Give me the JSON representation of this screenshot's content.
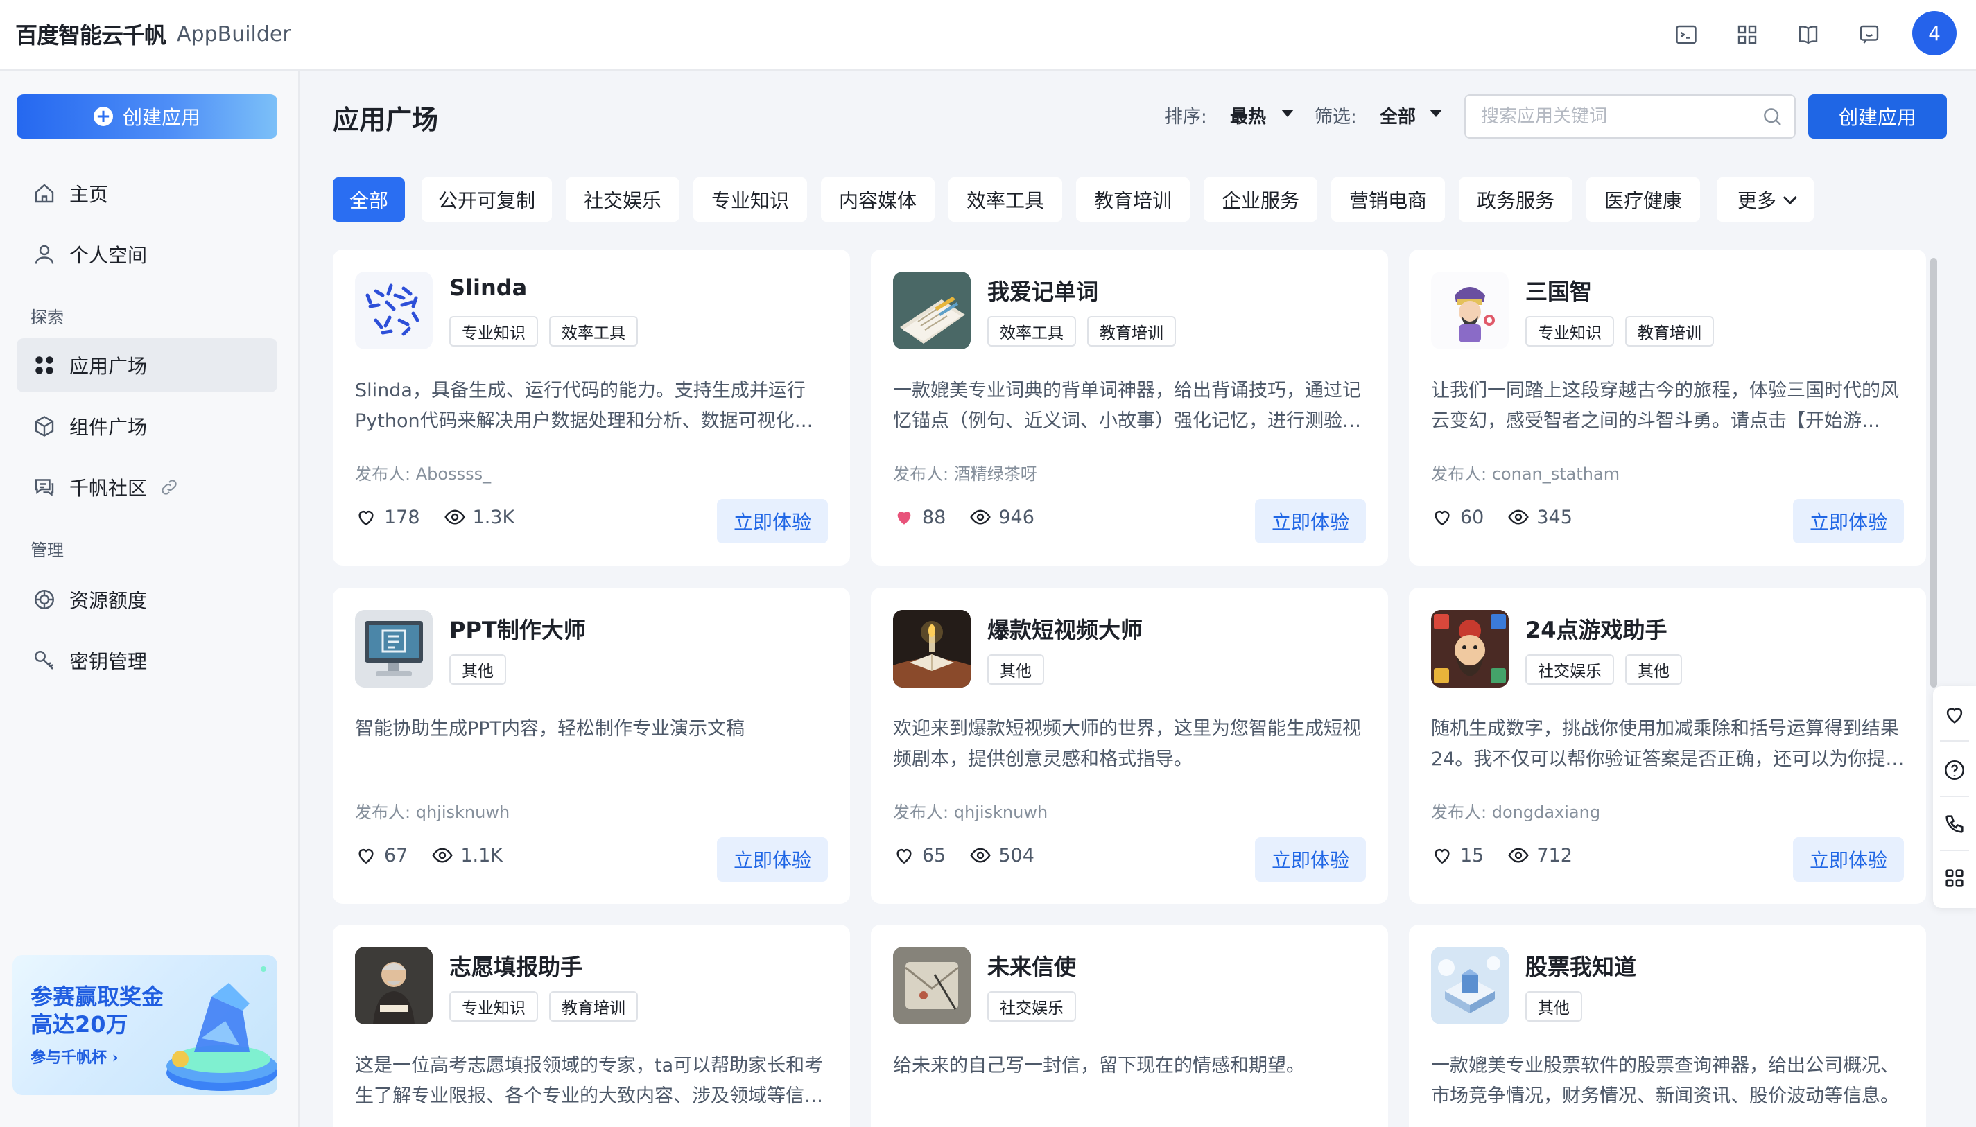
{
  "brand": {
    "logo": "百度智能云千帆",
    "product": "AppBuilder"
  },
  "topbar": {
    "icons": [
      "terminal-icon",
      "grid-icon",
      "book-icon",
      "feedback-icon"
    ],
    "avatar": "4"
  },
  "sidebar": {
    "create_label": "创建应用",
    "items": [
      {
        "label": "主页",
        "icon": "home-icon"
      },
      {
        "label": "个人空间",
        "icon": "user-icon"
      }
    ],
    "explore_label": "探索",
    "explore_items": [
      {
        "label": "应用广场",
        "icon": "apps-icon",
        "active": true
      },
      {
        "label": "组件广场",
        "icon": "cube-icon"
      },
      {
        "label": "千帆社区",
        "icon": "community-icon"
      }
    ],
    "manage_label": "管理",
    "manage_items": [
      {
        "label": "资源额度",
        "icon": "quota-icon"
      },
      {
        "label": "密钥管理",
        "icon": "key-icon"
      }
    ],
    "promo": {
      "title_line1": "参赛赢取奖金",
      "title_line2": "高达20万",
      "link": "参与千帆杯 ›"
    }
  },
  "main": {
    "title": "应用广场",
    "sort_label": "排序:",
    "sort_value": "最热",
    "filter_label": "筛选:",
    "filter_value": "全部",
    "search_placeholder": "搜索应用关键词",
    "create_label": "创建应用",
    "tabs": [
      "全部",
      "公开可复制",
      "社交娱乐",
      "专业知识",
      "内容媒体",
      "效率工具",
      "教育培训",
      "企业服务",
      "营销电商",
      "政务服务",
      "医疗健康",
      "更多"
    ],
    "active_tab": "全部",
    "publisher_prefix": "发布人:",
    "try_label": "立即体验",
    "cards": [
      {
        "name": "Slinda",
        "tags": [
          "专业知识",
          "效率工具"
        ],
        "desc": "Slinda，具备生成、运行代码的能力。支持生成并运行Python代码来解决用户数据处理和分析、数据可视化等问题。",
        "publisher": "Abossss_",
        "likes": "178",
        "liked": false,
        "views": "1.3K"
      },
      {
        "name": "我爱记单词",
        "tags": [
          "效率工具",
          "教育培训"
        ],
        "desc": "一款媲美专业词典的背单词神器，给出背诵技巧，通过记忆锚点（例句、近义词、小故事）强化记忆，进行测验巩固。",
        "publisher": "酒精绿茶呀",
        "likes": "88",
        "liked": true,
        "views": "946"
      },
      {
        "name": "三国智",
        "tags": [
          "专业知识",
          "教育培训"
        ],
        "desc": "让我们一同踏上这段穿越古今的旅程，体验三国时代的风云变幻，感受智者之间的斗智斗勇。请点击【开始游戏】。",
        "publisher": "conan_statham",
        "likes": "60",
        "liked": false,
        "views": "345"
      },
      {
        "name": "PPT制作大师",
        "tags": [
          "其他"
        ],
        "desc": "智能协助生成PPT内容，轻松制作专业演示文稿",
        "publisher": "qhjisknuwh",
        "likes": "67",
        "liked": false,
        "views": "1.1K"
      },
      {
        "name": "爆款短视频大师",
        "tags": [
          "其他"
        ],
        "desc": "欢迎来到爆款短视频大师的世界，这里为您智能生成短视频剧本，提供创意灵感和格式指导。",
        "publisher": "qhjisknuwh",
        "likes": "65",
        "liked": false,
        "views": "504"
      },
      {
        "name": "24点游戏助手",
        "tags": [
          "社交娱乐",
          "其他"
        ],
        "desc": "随机生成数字，挑战你使用加减乘除和括号运算得到结果24。我不仅可以帮你验证答案是否正确，还可以为你提供解题思路。",
        "publisher": "dongdaxiang",
        "likes": "15",
        "liked": false,
        "views": "712"
      },
      {
        "name": "志愿填报助手",
        "tags": [
          "专业知识",
          "教育培训"
        ],
        "desc": "这是一位高考志愿填报领域的专家，ta可以帮助家长和考生了解专业限报、各个专业的大致内容、涉及领域等信息。",
        "publisher": "",
        "likes": "",
        "liked": false,
        "views": ""
      },
      {
        "name": "未来信使",
        "tags": [
          "社交娱乐"
        ],
        "desc": "给未来的自己写一封信，留下现在的情感和期望。",
        "publisher": "",
        "likes": "",
        "liked": false,
        "views": ""
      },
      {
        "name": "股票我知道",
        "tags": [
          "其他"
        ],
        "desc": "一款媲美专业股票软件的股票查询神器，给出公司概况、市场竞争情况，财务情况、新闻资讯、股价波动等信息。",
        "publisher": "",
        "likes": "",
        "liked": false,
        "views": ""
      }
    ]
  },
  "float_panel": {
    "icons": [
      "heart-chat-icon",
      "help-icon",
      "phone-icon",
      "apps-grid-icon"
    ]
  }
}
